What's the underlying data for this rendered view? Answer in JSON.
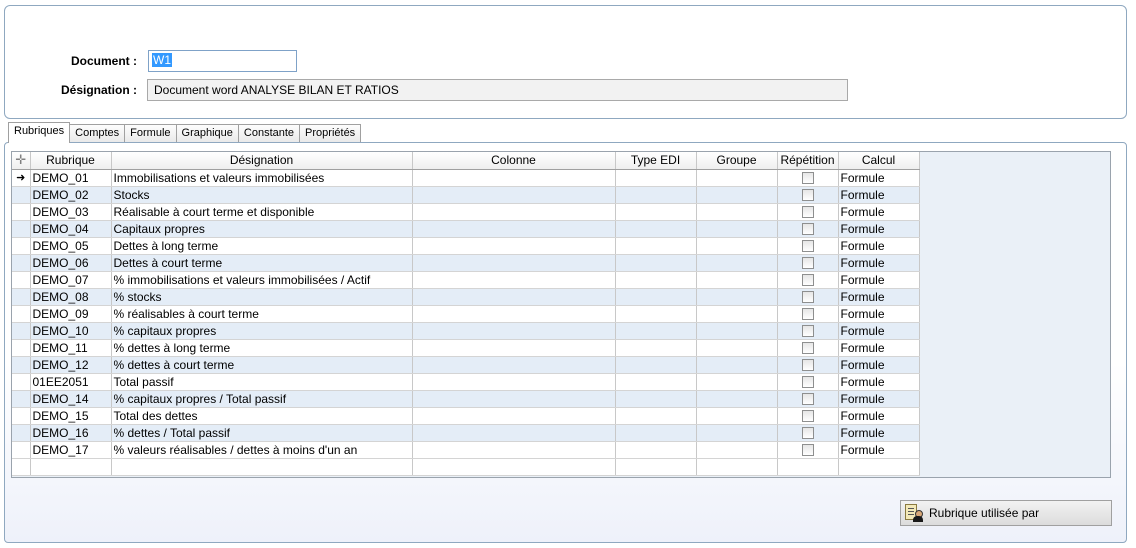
{
  "form": {
    "document_label": "Document :",
    "document_value": "W1",
    "designation_label": "Désignation :",
    "designation_value": "Document word ANALYSE BILAN ET RATIOS"
  },
  "tabs": [
    {
      "label": "Rubriques",
      "active": true
    },
    {
      "label": "Comptes"
    },
    {
      "label": "Formule"
    },
    {
      "label": "Graphique"
    },
    {
      "label": "Constante"
    },
    {
      "label": "Propriétés"
    }
  ],
  "grid": {
    "columns": [
      "Rubrique",
      "Désignation",
      "Colonne",
      "Type EDI",
      "Groupe",
      "Répétition",
      "Calcul"
    ],
    "rows": [
      {
        "rubrique": "DEMO_01",
        "designation": "Immobilisations et valeurs immobilisées",
        "calcul": "Formule"
      },
      {
        "rubrique": "DEMO_02",
        "designation": "Stocks",
        "calcul": "Formule"
      },
      {
        "rubrique": "DEMO_03",
        "designation": "Réalisable à court terme et disponible",
        "calcul": "Formule"
      },
      {
        "rubrique": "DEMO_04",
        "designation": "Capitaux propres",
        "calcul": "Formule"
      },
      {
        "rubrique": "DEMO_05",
        "designation": "Dettes à long terme",
        "calcul": "Formule"
      },
      {
        "rubrique": "DEMO_06",
        "designation": "Dettes à court terme",
        "calcul": "Formule"
      },
      {
        "rubrique": "DEMO_07",
        "designation": "% immobilisations et valeurs immobilisées / Actif",
        "calcul": "Formule"
      },
      {
        "rubrique": "DEMO_08",
        "designation": "% stocks",
        "calcul": "Formule"
      },
      {
        "rubrique": "DEMO_09",
        "designation": "% réalisables à court terme",
        "calcul": "Formule"
      },
      {
        "rubrique": "DEMO_10",
        "designation": "% capitaux propres",
        "calcul": "Formule"
      },
      {
        "rubrique": "DEMO_11",
        "designation": "% dettes à long terme",
        "calcul": "Formule"
      },
      {
        "rubrique": "DEMO_12",
        "designation": "% dettes à court terme",
        "calcul": "Formule"
      },
      {
        "rubrique": "01EE2051",
        "designation": "Total passif",
        "calcul": "Formule"
      },
      {
        "rubrique": "DEMO_14",
        "designation": "% capitaux propres / Total passif",
        "calcul": "Formule"
      },
      {
        "rubrique": "DEMO_15",
        "designation": "Total des dettes",
        "calcul": "Formule"
      },
      {
        "rubrique": "DEMO_16",
        "designation": "% dettes / Total passif",
        "calcul": "Formule"
      },
      {
        "rubrique": "DEMO_17",
        "designation": "% valeurs réalisables / dettes à moins d'un an",
        "calcul": "Formule"
      }
    ]
  },
  "actions": {
    "rubrique_utilisee_par": "Rubrique utilisée par"
  },
  "icons": {
    "add": "plus-icon",
    "current_row": "arrow-right-icon",
    "button": "document-user-icon"
  }
}
